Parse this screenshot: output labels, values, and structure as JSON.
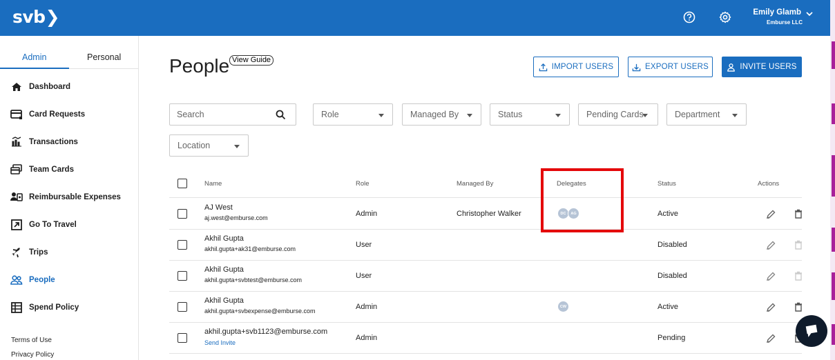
{
  "header": {
    "logo_text": "svb",
    "user_name": "Emily Glamb",
    "user_org": "Emburse LLC",
    "accent": "#1a6dbf"
  },
  "sidebar": {
    "tabs": [
      {
        "label": "Admin"
      },
      {
        "label": "Personal"
      }
    ],
    "items": [
      {
        "label": "Dashboard",
        "icon": "home-icon"
      },
      {
        "label": "Card Requests",
        "icon": "card-request-icon"
      },
      {
        "label": "Transactions",
        "icon": "transactions-icon"
      },
      {
        "label": "Team Cards",
        "icon": "team-cards-icon"
      },
      {
        "label": "Reimbursable Expenses",
        "icon": "reimbursable-icon"
      },
      {
        "label": "Go To Travel",
        "icon": "external-link-icon"
      },
      {
        "label": "Trips",
        "icon": "plane-icon"
      },
      {
        "label": "People",
        "icon": "people-icon"
      },
      {
        "label": "Spend Policy",
        "icon": "policy-icon"
      }
    ],
    "footer": [
      "Terms of Use",
      "Privacy Policy"
    ]
  },
  "main": {
    "title": "People",
    "view_guide": "View Guide",
    "buttons": {
      "import": "IMPORT USERS",
      "export": "EXPORT USERS",
      "invite": "INVITE USERS"
    },
    "search_placeholder": "Search",
    "filters": [
      "Role",
      "Managed By",
      "Status",
      "Pending Cards",
      "Department",
      "Location"
    ],
    "columns": {
      "name": "Name",
      "role": "Role",
      "managed_by": "Managed By",
      "delegates": "Delegates",
      "status": "Status",
      "actions": "Actions"
    },
    "rows": [
      {
        "name": "AJ West",
        "email": "aj.west@emburse.com",
        "role": "Admin",
        "managed_by": "Christopher Walker",
        "delegates": [
          "DC",
          "AG"
        ],
        "status": "Active"
      },
      {
        "name": "Akhil Gupta",
        "email": "akhil.gupta+ak31@emburse.com",
        "role": "User",
        "managed_by": "",
        "delegates": [],
        "status": "Disabled"
      },
      {
        "name": "Akhil Gupta",
        "email": "akhil.gupta+svbtest@emburse.com",
        "role": "User",
        "managed_by": "",
        "delegates": [],
        "status": "Disabled"
      },
      {
        "name": "Akhil Gupta",
        "email": "akhil.gupta+svbexpense@emburse.com",
        "role": "Admin",
        "managed_by": "",
        "delegates": [
          "CW"
        ],
        "status": "Active"
      },
      {
        "name": "akhil.gupta+svb1123@emburse.com",
        "email": "",
        "send_invite": "Send Invite",
        "role": "Admin",
        "managed_by": "",
        "delegates": [],
        "status": "Pending"
      }
    ]
  }
}
